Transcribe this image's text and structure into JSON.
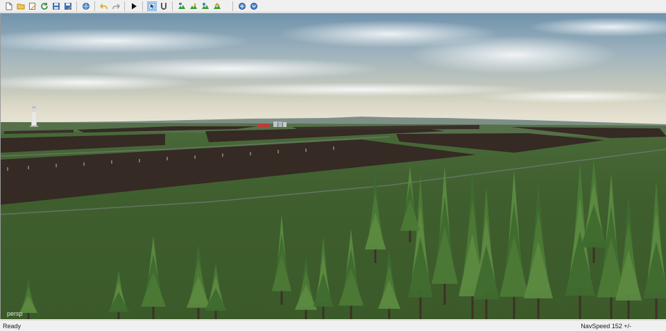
{
  "toolbar": {
    "buttons": [
      {
        "name": "new-file-icon"
      },
      {
        "name": "open-folder-icon"
      },
      {
        "name": "edit-icon"
      },
      {
        "name": "refresh-icon"
      },
      {
        "name": "save-icon"
      },
      {
        "name": "save-as-icon"
      },
      {
        "name": "globe-settings-icon"
      },
      {
        "name": "undo-icon"
      },
      {
        "name": "redo-icon"
      },
      {
        "name": "play-icon"
      },
      {
        "name": "select-icon"
      },
      {
        "name": "magnet-icon"
      },
      {
        "name": "terrain-tool-icon"
      },
      {
        "name": "terrain-paint-icon"
      },
      {
        "name": "terrain-foliage-icon"
      },
      {
        "name": "terrain-detail-icon"
      },
      {
        "name": "navigation-globe-icon"
      },
      {
        "name": "camera-globe-icon"
      }
    ]
  },
  "viewport": {
    "camera_label": "persp"
  },
  "status": {
    "left": "Ready",
    "right": "NavSpeed 152 +/-"
  }
}
